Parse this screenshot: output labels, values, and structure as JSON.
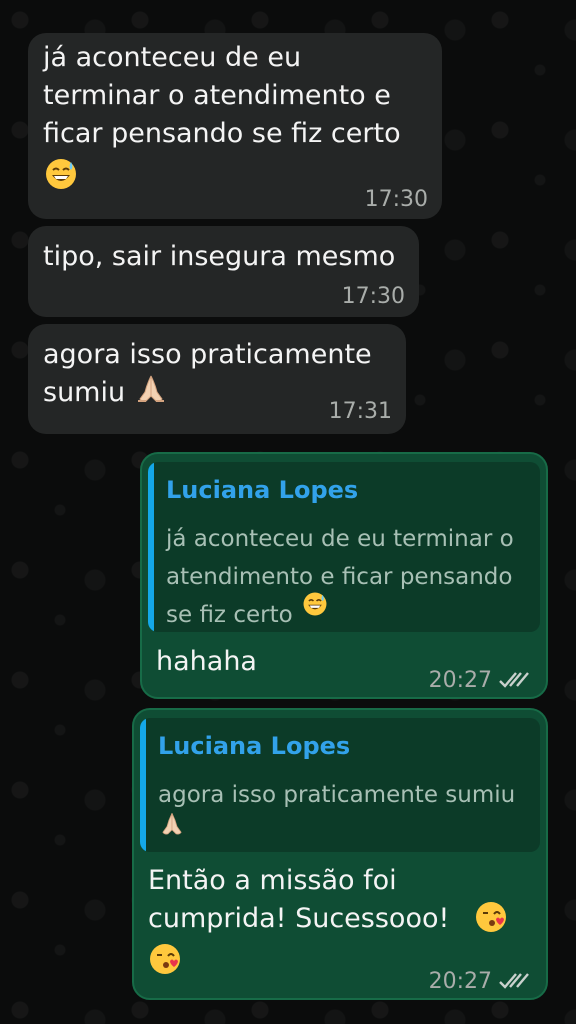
{
  "chat": {
    "messages": [
      {
        "direction": "incoming",
        "text": "já aconteceu de eu\nterminar o atendimento e\nficar pensando se fiz certo",
        "emoji": "sweat-smile-emoji",
        "time": "17:30"
      },
      {
        "direction": "incoming",
        "text": "tipo, sair insegura mesmo",
        "time": "17:30"
      },
      {
        "direction": "incoming",
        "text": "agora isso praticamente\nsumiu",
        "emoji": "folded-hands-emoji",
        "time": "17:31"
      },
      {
        "direction": "outgoing",
        "quote_author": "Luciana Lopes",
        "quote_text": "já aconteceu de eu terminar o\natendimento e ficar pensando\nse fiz certo",
        "quote_emoji": "sweat-smile-emoji",
        "text": "hahaha",
        "time": "20:27",
        "status": "read"
      },
      {
        "direction": "outgoing",
        "quote_author": "Luciana Lopes",
        "quote_text": "agora isso praticamente sumiu",
        "quote_emoji": "folded-hands-emoji",
        "text": "Então a missão foi\ncumprida! Sucessooo!",
        "emoji": "kiss-emoji",
        "time": "20:27",
        "status": "read"
      }
    ]
  },
  "colors": {
    "background": "#0b0c0c",
    "incoming_bubble": "#242626",
    "outgoing_bubble": "#0f4d34",
    "quote_accent": "#14a8e8",
    "quote_author": "#32a2ea",
    "timestamp": "#a9adaa"
  }
}
